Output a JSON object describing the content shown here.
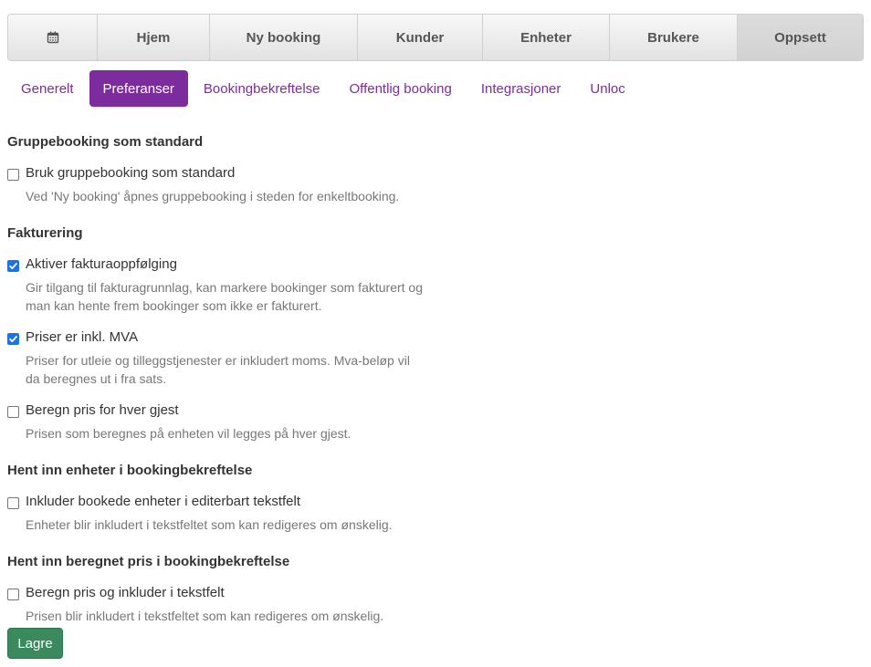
{
  "topnav": {
    "items": [
      {
        "label": "",
        "icon": "calendar-icon"
      },
      {
        "label": "Hjem"
      },
      {
        "label": "Ny booking"
      },
      {
        "label": "Kunder"
      },
      {
        "label": "Enheter"
      },
      {
        "label": "Brukere"
      },
      {
        "label": "Oppsett",
        "active": true
      }
    ]
  },
  "subnav": {
    "items": [
      {
        "label": "Generelt"
      },
      {
        "label": "Preferanser",
        "active": true
      },
      {
        "label": "Bookingbekreftelse"
      },
      {
        "label": "Offentlig booking"
      },
      {
        "label": "Integrasjoner"
      },
      {
        "label": "Unloc"
      }
    ]
  },
  "sections": [
    {
      "title": "Gruppebooking som standard",
      "options": [
        {
          "label": "Bruk gruppebooking som standard",
          "checked": false,
          "help": "Ved 'Ny booking' åpnes gruppebooking i steden for enkeltbooking."
        }
      ]
    },
    {
      "title": "Fakturering",
      "options": [
        {
          "label": "Aktiver fakturaoppfølging",
          "checked": true,
          "help": "Gir tilgang til fakturagrunnlag, kan markere bookinger som fakturert og man kan hente frem bookinger som ikke er fakturert."
        },
        {
          "label": "Priser er inkl. MVA",
          "checked": true,
          "help": "Priser for utleie og tilleggstjenester er inkludert moms. Mva-beløp vil da beregnes ut i fra sats."
        },
        {
          "label": "Beregn pris for hver gjest",
          "checked": false,
          "help": "Prisen som beregnes på enheten vil legges på hver gjest."
        }
      ]
    },
    {
      "title": "Hent inn enheter i bookingbekreftelse",
      "options": [
        {
          "label": "Inkluder bookede enheter i editerbart tekstfelt",
          "checked": false,
          "help": "Enheter blir inkludert i tekstfeltet som kan redigeres om ønskelig."
        }
      ]
    },
    {
      "title": "Hent inn beregnet pris i bookingbekreftelse",
      "options": [
        {
          "label": "Beregn pris og inkluder i tekstfelt",
          "checked": false,
          "help": "Prisen blir inkludert i tekstfeltet som kan redigeres om ønskelig."
        }
      ]
    }
  ],
  "save_button": {
    "label": "Lagre"
  },
  "colors": {
    "accent": "#7d2c9e",
    "save": "#3a8a5e",
    "checkbox": "#1a73e8"
  }
}
